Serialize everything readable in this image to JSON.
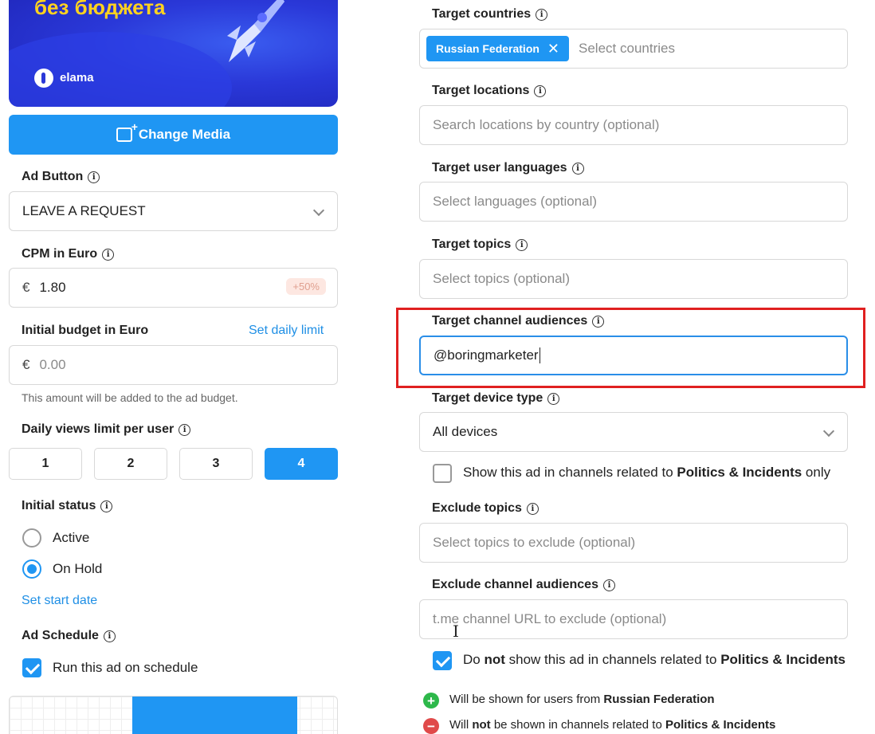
{
  "banner": {
    "title": "без бюджета",
    "brand": "elama"
  },
  "left": {
    "change_media": "Change Media",
    "ad_button": {
      "label": "Ad Button",
      "value": "LEAVE A REQUEST"
    },
    "cpm": {
      "label": "CPM in Euro",
      "currency": "€",
      "value": "1.80",
      "badge": "+50%"
    },
    "budget": {
      "label": "Initial budget in Euro",
      "link": "Set daily limit",
      "currency": "€",
      "placeholder": "0.00",
      "hint": "This amount will be added to the ad budget."
    },
    "daily_views": {
      "label": "Daily views limit per user",
      "options": [
        "1",
        "2",
        "3",
        "4"
      ],
      "selected": "4"
    },
    "initial_status": {
      "label": "Initial status",
      "options": [
        "Active",
        "On Hold"
      ],
      "selected": "On Hold",
      "link": "Set start date"
    },
    "ad_schedule": {
      "label": "Ad Schedule",
      "checkbox": "Run this ad on schedule",
      "checked": true
    }
  },
  "right": {
    "countries": {
      "label": "Target countries",
      "chip": "Russian Federation",
      "placeholder": "Select countries"
    },
    "locations": {
      "label": "Target locations",
      "placeholder": "Search locations by country (optional)"
    },
    "languages": {
      "label": "Target user languages",
      "placeholder": "Select languages (optional)"
    },
    "topics": {
      "label": "Target topics",
      "placeholder": "Select topics (optional)"
    },
    "channel_audiences": {
      "label": "Target channel audiences",
      "value": "@boringmarketer"
    },
    "device": {
      "label": "Target device type",
      "value": "All devices"
    },
    "politics_only": {
      "pre": "Show this ad in channels related to ",
      "bold": "Politics & Incidents",
      "post": " only",
      "checked": false
    },
    "exclude_topics": {
      "label": "Exclude topics",
      "placeholder": "Select topics to exclude (optional)"
    },
    "exclude_channels": {
      "label": "Exclude channel audiences",
      "placeholder": "t.me channel URL to exclude (optional)"
    },
    "no_politics": {
      "pre": "Do ",
      "bold1": "not",
      "mid": " show this ad in channels related to ",
      "bold2": "Politics & Incidents",
      "checked": true
    },
    "summary": [
      {
        "pre": "Will be shown for users from ",
        "bold": "Russian Federation",
        "type": "plus"
      },
      {
        "pre": "Will ",
        "bold": "not",
        "mid": " be shown in channels related to ",
        "bold2": "Politics & Incidents",
        "type": "minus"
      }
    ]
  }
}
